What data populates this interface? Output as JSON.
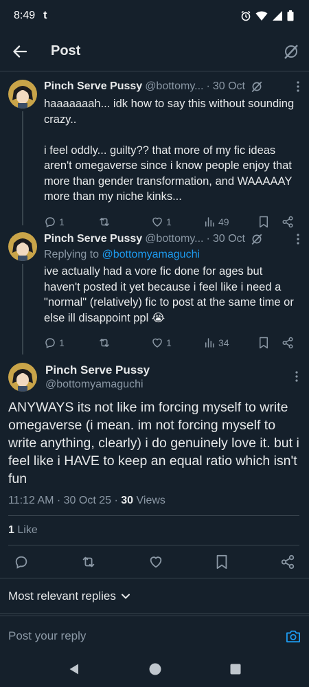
{
  "status": {
    "time": "8:49",
    "app_glyph": "t"
  },
  "header": {
    "title": "Post"
  },
  "thread": [
    {
      "name": "Pinch Serve Pussy",
      "handle": "@bottomy...",
      "date": "30 Oct",
      "text": "haaaaaaah... idk how to say this without sounding crazy..\n\ni feel oddly... guilty?? that more of my fic ideas aren't omegaverse since i know people enjoy that more than gender transformation, and WAAAAAY more than my niche kinks...",
      "replies": "1",
      "retweets": "",
      "likes": "1",
      "views": "49"
    },
    {
      "name": "Pinch Serve Pussy",
      "handle": "@bottomy...",
      "date": "30 Oct",
      "replying_label": "Replying to",
      "replying_to": "@bottomyamaguchi",
      "text": "ive actually had a vore fic done for ages but haven't posted it yet because i feel like i need a \"normal\" (relatively) fic to post at the same time or else ill disappoint ppl 😭",
      "replies": "1",
      "retweets": "",
      "likes": "1",
      "views": "34"
    }
  ],
  "main": {
    "name": "Pinch Serve Pussy",
    "handle": "@bottomyamaguchi",
    "text": "ANYWAYS its not like im forcing myself to write omegaverse (i mean. im not forcing myself to write anything, clearly) i do genuinely love it. but i feel like i HAVE to keep an equal ratio which isn't fun",
    "time": "11:12 AM",
    "date": "30 Oct 25",
    "views_count": "30",
    "views_label": "Views",
    "likes_count": "1",
    "likes_label": "Like"
  },
  "replies_sort": {
    "label": "Most relevant replies"
  },
  "compose": {
    "placeholder": "Post your reply"
  },
  "colors": {
    "background": "#15202b",
    "accent": "#1d9bf0",
    "muted": "#8b98a5",
    "border": "#38444d"
  }
}
